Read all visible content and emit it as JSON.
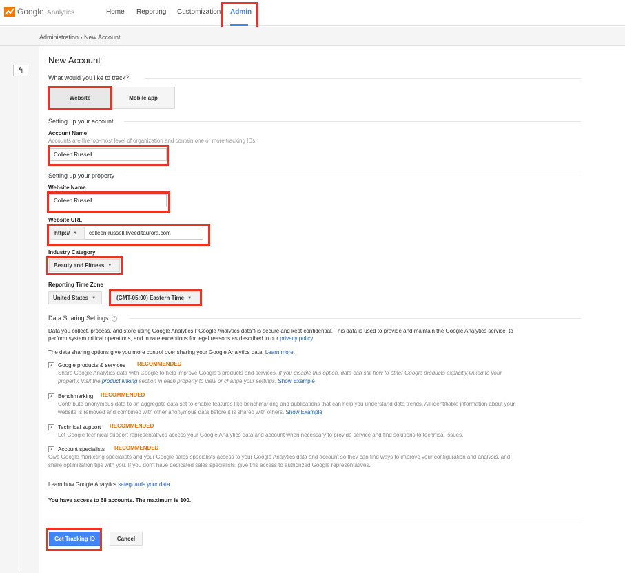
{
  "header": {
    "logo_text": "Google",
    "logo_sub": "Analytics",
    "nav": [
      "Home",
      "Reporting",
      "Customization",
      "Admin"
    ],
    "active_nav": "Admin"
  },
  "breadcrumb": "Administration › New Account",
  "back_icon": "back-arrow-icon",
  "page_title": "New Account",
  "track": {
    "question": "What would you like to track?",
    "options": [
      "Website",
      "Mobile app"
    ],
    "selected": "Website"
  },
  "account": {
    "section": "Setting up your account",
    "label": "Account Name",
    "help": "Accounts are the top-most level of organization and contain one or more tracking IDs.",
    "value": "Colleen Russell"
  },
  "property": {
    "section": "Setting up your property",
    "website_name_label": "Website Name",
    "website_name_value": "Colleen Russell",
    "url_label": "Website URL",
    "protocol": "http://",
    "url_value": "colleen-russell.liveeditaurora.com",
    "industry_label": "Industry Category",
    "industry_value": "Beauty and Fitness",
    "timezone_label": "Reporting Time Zone",
    "country_value": "United States",
    "timezone_value": "(GMT-05:00) Eastern Time"
  },
  "sharing": {
    "section": "Data Sharing Settings",
    "intro_1a": "Data you collect, process, and store using Google Analytics (\"Google Analytics data\") is secure and kept confidential. This data is used to provide and maintain the Google Analytics service, to",
    "intro_1b": "perform system critical operations, and in rare exceptions for legal reasons as described in our ",
    "privacy_link": "privacy policy.",
    "intro_2": "The data sharing options give you more control over sharing your Google Analytics data. ",
    "learn_more": "Learn more.",
    "recommended": "RECOMMENDED",
    "options": [
      {
        "label": "Google products & services",
        "desc_a": "Share Google Analytics data with Google to help improve Google's products and services. ",
        "desc_a_italic": "If you disable this option, data can still flow to other Google products explicitly linked to your",
        "desc_b_italic_1": "property. Visit the ",
        "desc_b_link": "product linking",
        "desc_b_italic_2": " section in each property to view or change your settings.",
        "show_example": "Show Example",
        "checked": true
      },
      {
        "label": "Benchmarking",
        "desc_a": "Contribute anonymous data to an aggregate data set to enable features like benchmarking and publications that can help you understand data trends. All identifiable information about your",
        "desc_b": "website is removed and combined with other anonymous data before it is shared with others. ",
        "show_example": "Show Example",
        "checked": true
      },
      {
        "label": "Technical support",
        "desc_a": "Let Google technical support representatives access your Google Analytics data and account when necessary to provide service and find solutions to technical issues.",
        "checked": true
      },
      {
        "label": "Account specialists",
        "desc_a": "Give Google marketing specialists and your Google sales specialists access to your Google Analytics data and account so they can find ways to improve your configuration and analysis, and",
        "desc_b": "share optimization tips with you. If you don't have dedicated sales specialists, give this access to authorized Google representatives.",
        "checked": true
      }
    ],
    "learn_how": "Learn how Google Analytics ",
    "safeguards_link": "safeguards your data."
  },
  "access_note": "You have access to 68 accounts. The maximum is 100.",
  "buttons": {
    "primary": "Get Tracking ID",
    "cancel": "Cancel"
  },
  "colors": {
    "accent": "#4285f4",
    "highlight": "#ea3323",
    "recommended": "#e8710a",
    "link": "#1a5ec9"
  }
}
